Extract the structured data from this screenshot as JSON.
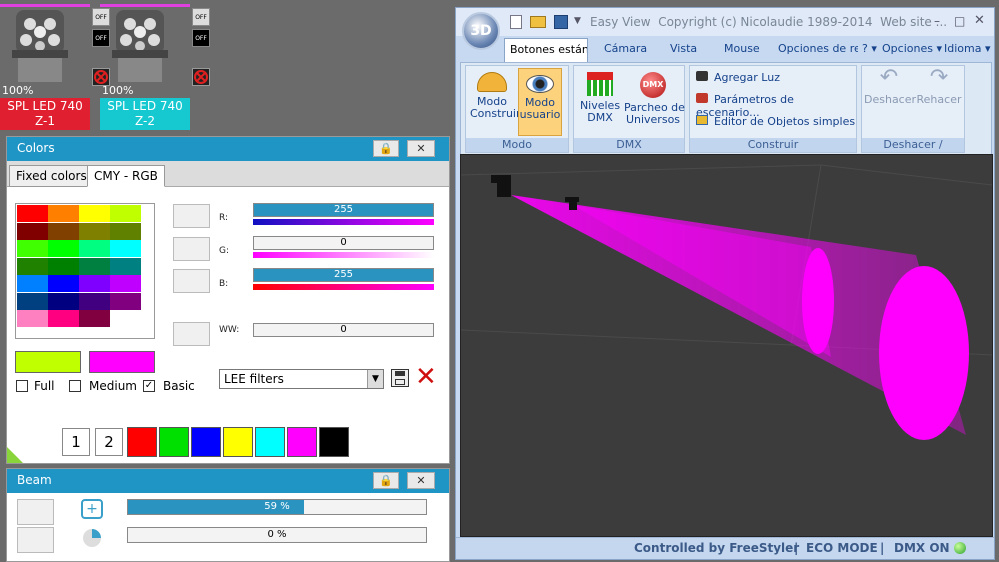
{
  "fixtures": [
    {
      "percent": "100%",
      "name": "SPL LED 740",
      "zone": "Z-1",
      "color": "#e02030",
      "off_top": "OFF",
      "off_bottom": "OFF"
    },
    {
      "percent": "100%",
      "name": "SPL LED 740",
      "zone": "Z-2",
      "color": "#16c8d0",
      "off_top": "OFF",
      "off_bottom": "OFF"
    }
  ],
  "colors_panel": {
    "title": "Colors",
    "tabs": [
      "Fixed colors",
      "CMY - RGB"
    ],
    "channels": [
      {
        "label": "R:",
        "value": "255",
        "fill": 1.0
      },
      {
        "label": "G:",
        "value": "0",
        "fill": 0.0
      },
      {
        "label": "B:",
        "value": "255",
        "fill": 1.0
      },
      {
        "label": "WW:",
        "value": "0",
        "fill": 0.0
      }
    ],
    "filter_select": "LEE filters",
    "checkboxes": [
      {
        "label": "Full",
        "checked": false
      },
      {
        "label": "Medium",
        "checked": false
      },
      {
        "label": "Basic",
        "checked": true
      }
    ],
    "page_buttons": [
      "1",
      "2"
    ],
    "quick_colors": [
      "#ff0000",
      "#00e000",
      "#0000ff",
      "#ffff00",
      "#00ffff",
      "#ff00ff",
      "#000000"
    ],
    "palette": [
      [
        "#ff0000",
        "#ff8000",
        "#ffff00",
        "#c0ff00"
      ],
      [
        "#800000",
        "#804000",
        "#808000",
        "#608000"
      ],
      [
        "#40ff00",
        "#00ff00",
        "#00ff80",
        "#00ffff"
      ],
      [
        "#208000",
        "#008000",
        "#008040",
        "#008080"
      ],
      [
        "#0080ff",
        "#0000ff",
        "#8000ff",
        "#c000ff"
      ],
      [
        "#004080",
        "#000080",
        "#400080",
        "#800080"
      ],
      [
        "#ff80c0",
        "#ff0080",
        "#800040",
        "#ffffff"
      ]
    ],
    "current_color_1": "#c0ff00",
    "current_color_2": "#ff00ff"
  },
  "beam_panel": {
    "title": "Beam",
    "sliders": [
      {
        "value": "59 %",
        "fill": 0.59
      },
      {
        "value": "0 %",
        "fill": 0.0
      }
    ]
  },
  "app": {
    "title_text": "Easy View  Copyright (c) Nicolaudie 1989-2014  Web site ...",
    "logo": "3D",
    "tabs": [
      "Botones están",
      "Cámara",
      "Vista",
      "Mouse",
      "Opciones de re"
    ],
    "right_tabs": [
      "? ▾",
      "Opciones ▾",
      "Idioma ▾"
    ],
    "groups": {
      "modo": {
        "title": "Modo",
        "buttons": [
          "Modo\nConstruir",
          "Modo\nusuario"
        ]
      },
      "dmx": {
        "title": "DMX",
        "buttons": [
          "Niveles\nDMX",
          "Parcheo de\nUniversos"
        ]
      },
      "construir": {
        "title": "Construir",
        "items": [
          "Agregar Luz",
          "Parámetros de escenario...",
          "Editor de Objetos simples"
        ]
      },
      "undo": {
        "title": "Deshacer / Rehacer",
        "buttons": [
          "Deshacer",
          "Rehacer"
        ]
      }
    },
    "status": {
      "controlled": "Controlled by FreeStyler",
      "eco": "ECO MODE",
      "dmx": "DMX ON"
    }
  }
}
